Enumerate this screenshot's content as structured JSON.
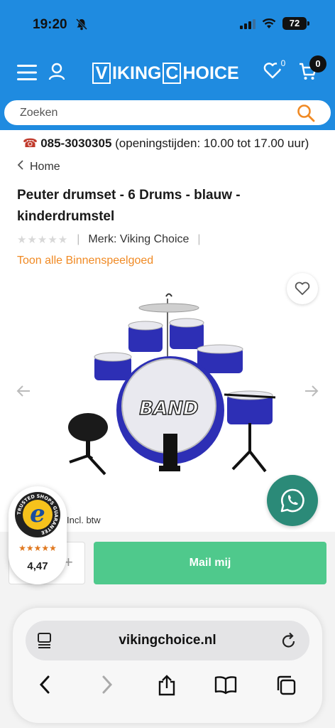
{
  "status_bar": {
    "time": "19:20",
    "battery": "72"
  },
  "header": {
    "logo_part1": "V",
    "logo_part2": "IKING",
    "logo_part3": "C",
    "logo_part4": "HOICE",
    "wishlist_count": "0",
    "cart_count": "0"
  },
  "search": {
    "placeholder": "Zoeken"
  },
  "contact": {
    "phone": "085-3030305",
    "hours": "(openingstijden: 10.00 tot 17.00 uur)"
  },
  "breadcrumb": {
    "home": "Home"
  },
  "product": {
    "title": "Peuter drumset - 6 Drums - blauw - kinderdrumstel",
    "rating_stars": "★★★★★",
    "brand_label": "Merk:",
    "brand": "Viking Choice",
    "category_link": "Toon alle Binnenspeelgoed",
    "vat_note": "Incl. btw",
    "drum_text": "BAND"
  },
  "purchase": {
    "qty_plus": "+",
    "mail_button": "Mail mij"
  },
  "trusted_shops": {
    "badge_text": "TRUSTED SHOPS GUARANTEE",
    "letter": "e",
    "stars": "★★★★★",
    "score": "4,47"
  },
  "browser": {
    "url": "vikingchoice.nl"
  },
  "colors": {
    "brand_blue": "#1f8be0",
    "accent_orange": "#f08a24",
    "button_green": "#4fc98c",
    "whatsapp_green": "#2b8a78"
  }
}
